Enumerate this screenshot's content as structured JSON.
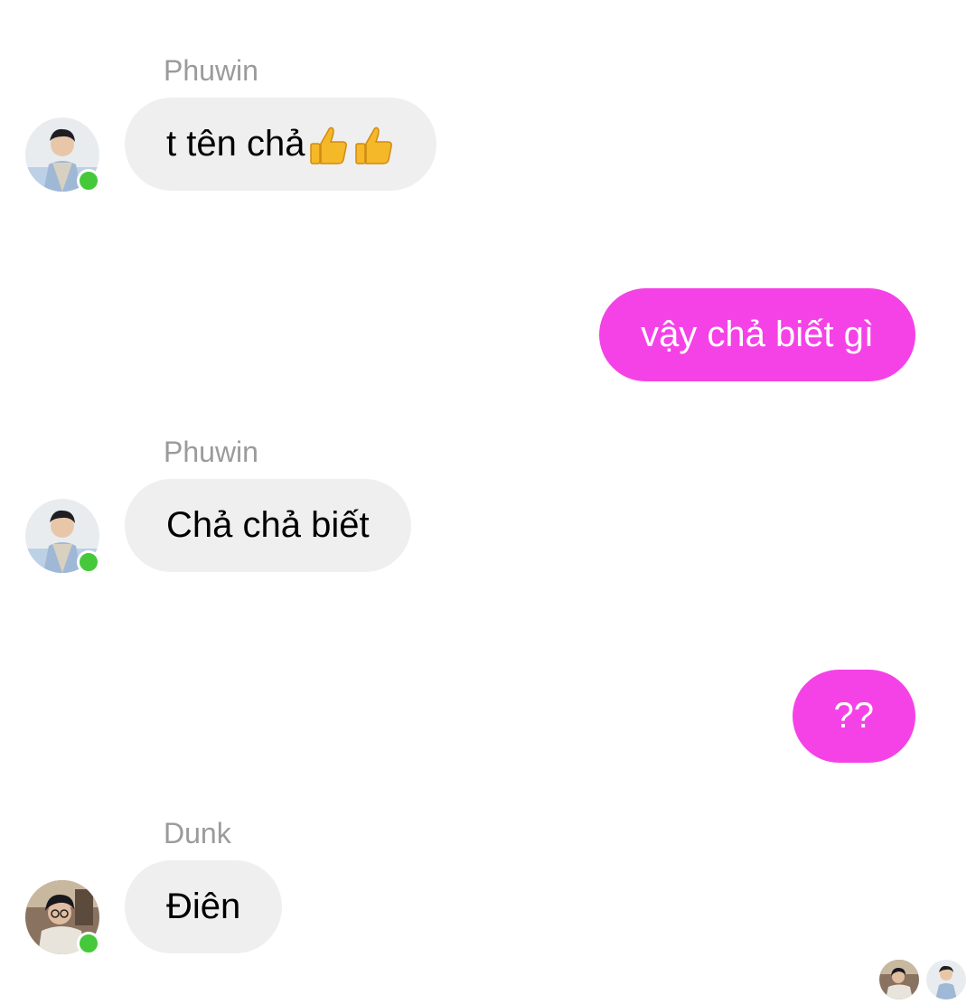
{
  "conversation": {
    "messages": [
      {
        "sender": "Phuwin",
        "direction": "incoming",
        "text": "t tên chả",
        "emoji": [
          "thumbs-up-icon",
          "thumbs-up-icon"
        ],
        "online": true
      },
      {
        "sender": "",
        "direction": "outgoing",
        "text": "vậy chả biết gì"
      },
      {
        "sender": "Phuwin",
        "direction": "incoming",
        "text": "Chả chả biết",
        "online": true
      },
      {
        "sender": "",
        "direction": "outgoing",
        "text": "??"
      },
      {
        "sender": "Dunk",
        "direction": "incoming",
        "text": "Điên",
        "online": true
      }
    ],
    "read_receipts": [
      "Dunk",
      "Phuwin"
    ]
  },
  "colors": {
    "outgoing_bubble": "#f542e6",
    "incoming_bubble": "#efefef",
    "online_dot": "#45c93a",
    "sender_name": "#9b9b9b"
  }
}
